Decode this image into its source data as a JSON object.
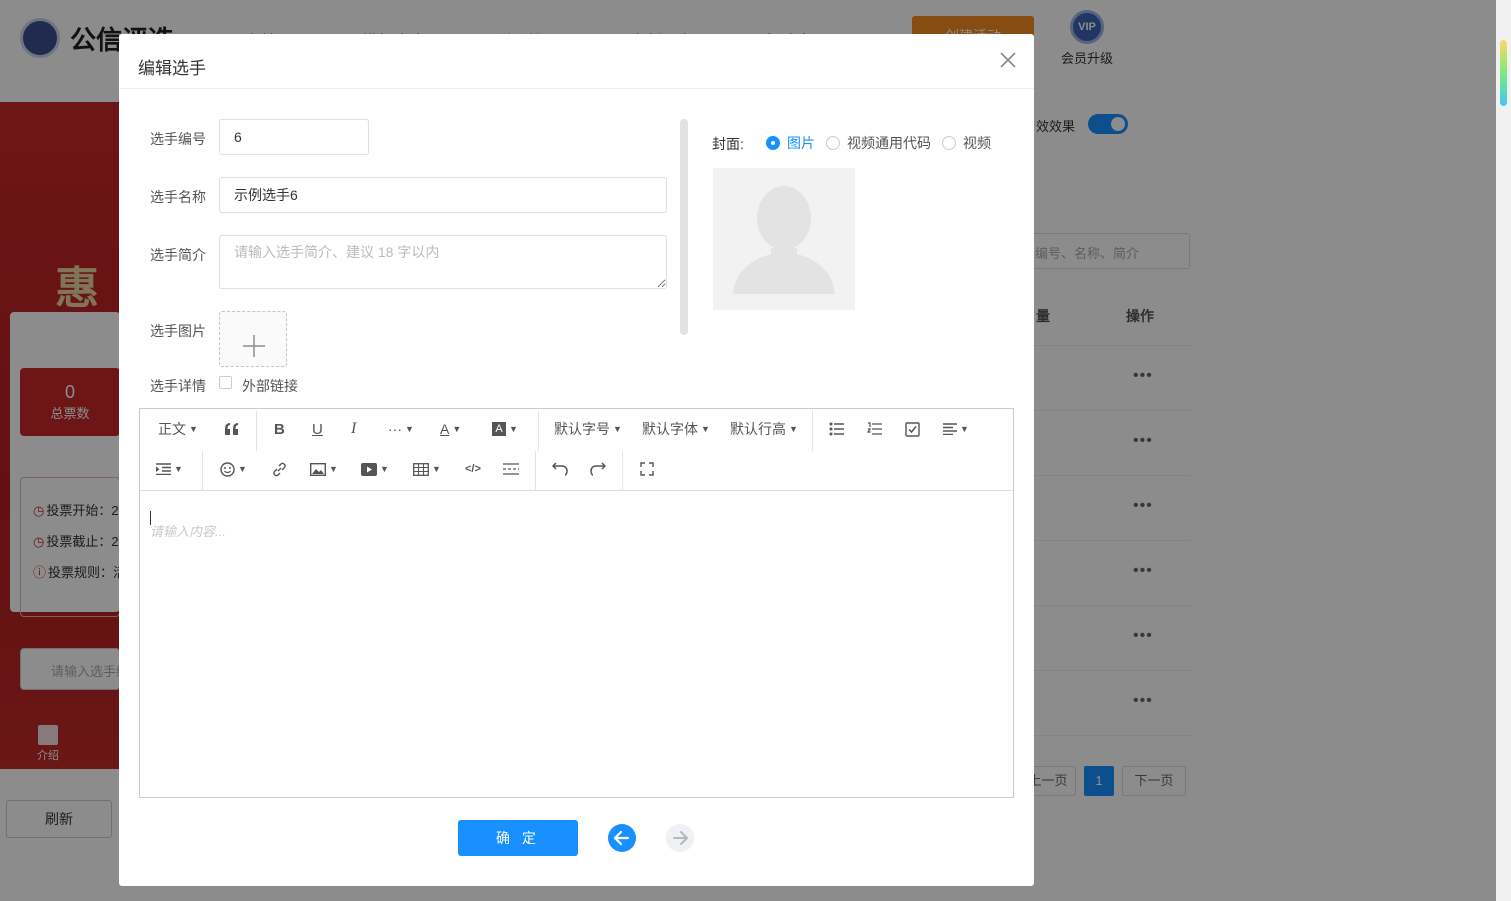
{
  "background": {
    "logo_text": "公信评选",
    "nav": [
      "用户首页",
      "模板大全",
      "活动管理",
      "定制服务",
      "帮助中心"
    ],
    "create_label": "创建活动",
    "vip_badge": "VIP",
    "vip_label": "会员升级",
    "poster_title": "惠民",
    "stat_value": "0",
    "stat_label": "总票数",
    "vote_lines": [
      "投票开始：2",
      "投票截止：2",
      "投票规则：活"
    ],
    "poster_search": "请输入选手编",
    "poster_intro": "介绍",
    "refresh_label": "刷新",
    "effect_label": "效效果",
    "right_search": "编号、名称、简介",
    "col_count": "量",
    "col_action": "操作",
    "row_action": "•••",
    "prev_page": "上一页",
    "current_page": "1",
    "next_page": "下一页"
  },
  "modal": {
    "title": "编辑选手",
    "fields": {
      "number_label": "选手编号",
      "number_value": "6",
      "name_label": "选手名称",
      "name_value": "示例选手6",
      "intro_label": "选手简介",
      "intro_placeholder": "请输入选手简介、建议 18 字以内",
      "image_label": "选手图片",
      "detail_label": "选手详情",
      "external_link_label": "外部链接"
    },
    "cover": {
      "label": "封面:",
      "options": [
        "图片",
        "视频通用代码",
        "视频"
      ],
      "selected": "图片"
    },
    "editor": {
      "paragraph": "正文",
      "font_size": "默认字号",
      "font_family": "默认字体",
      "line_height": "默认行高",
      "placeholder": "请输入内容..."
    },
    "confirm_label": "确 定"
  }
}
